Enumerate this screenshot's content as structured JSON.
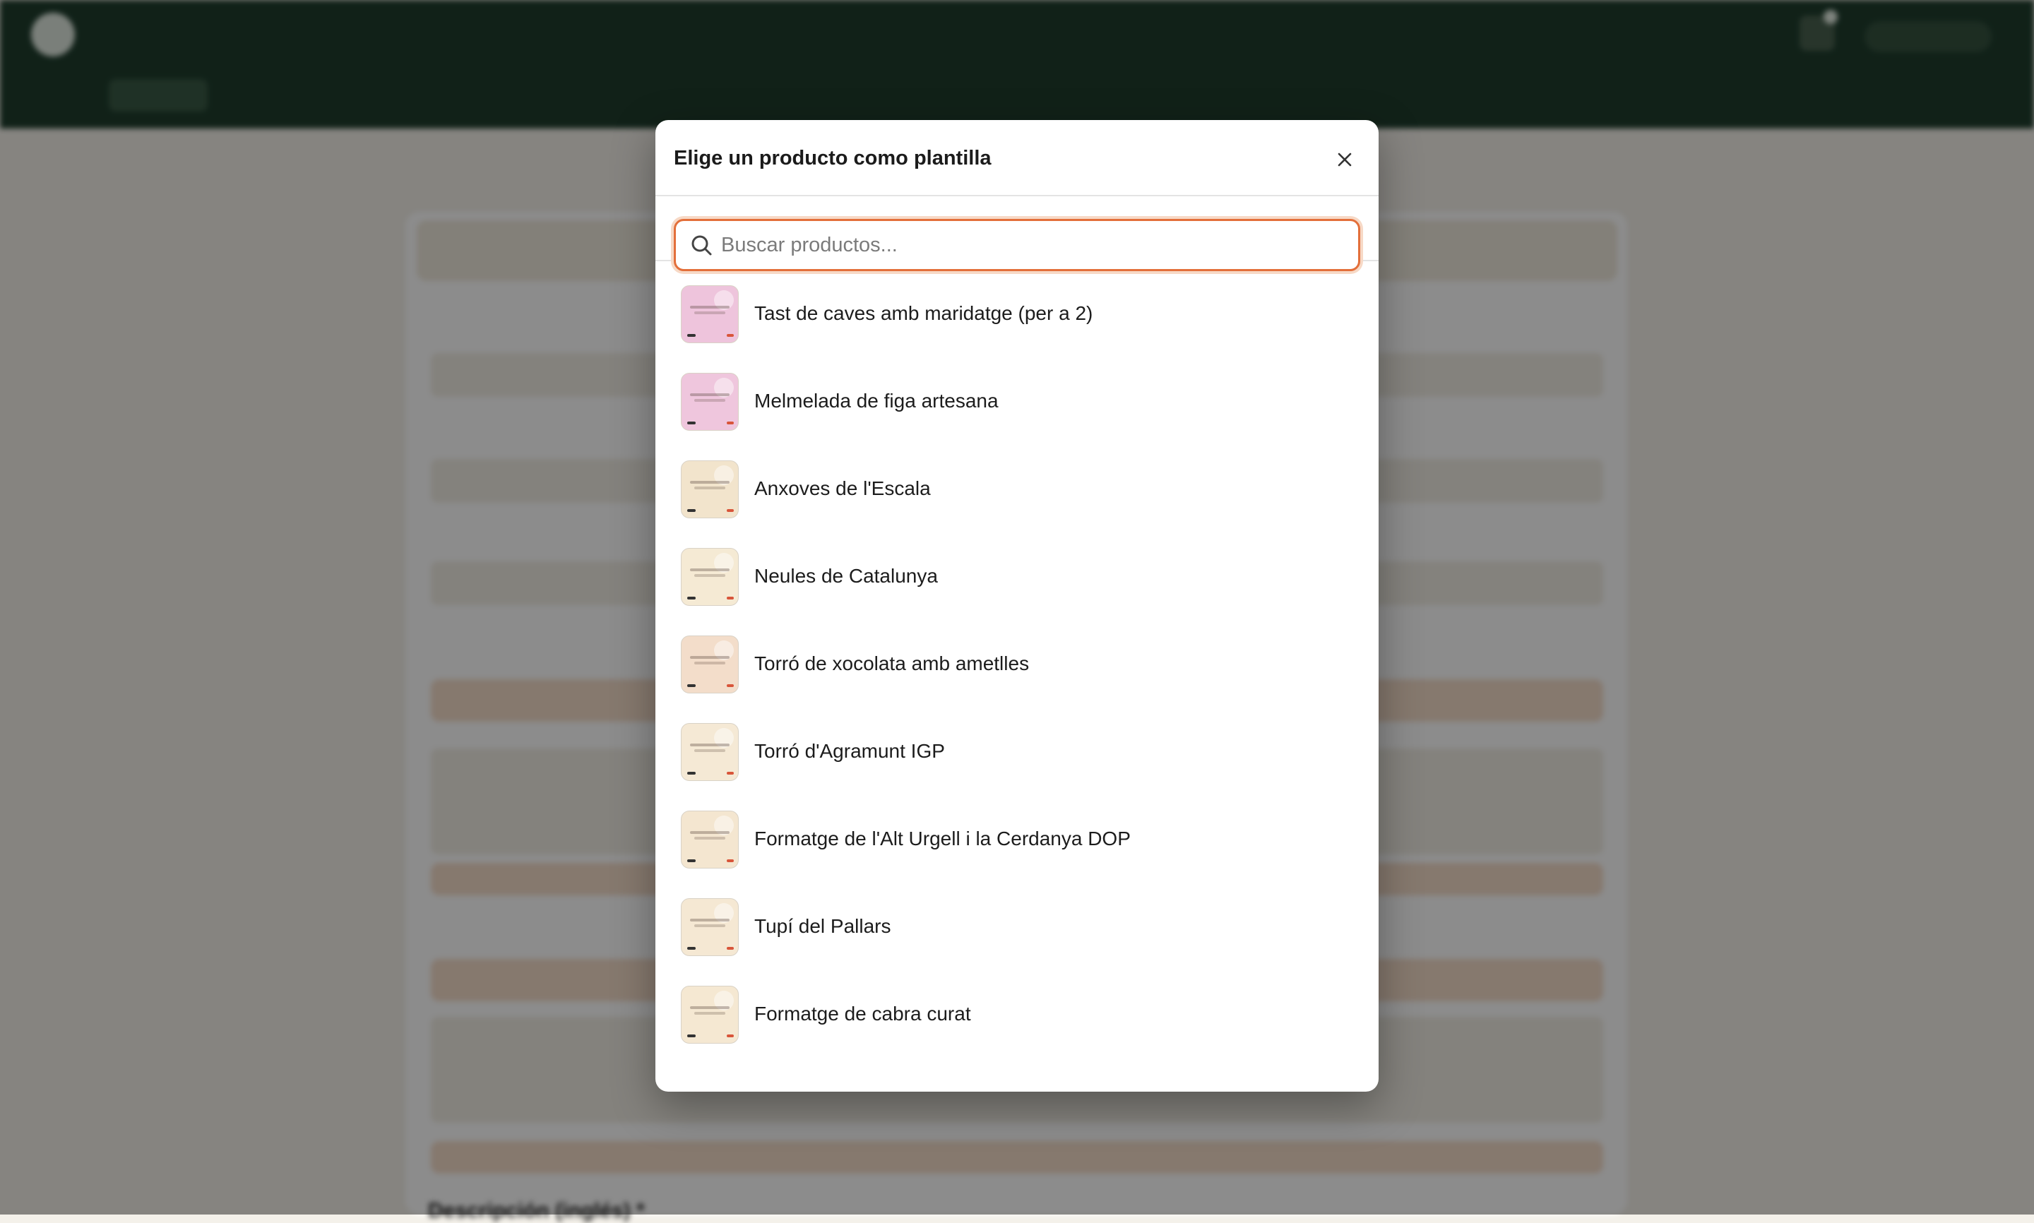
{
  "modal": {
    "title": "Elige un producto como plantilla",
    "search": {
      "placeholder": "Buscar productos...",
      "value": ""
    },
    "items": [
      {
        "label": "Tast de caves amb maridatge (per a 2)",
        "thumb_color": "#eec4dc"
      },
      {
        "label": "Melmelada de figa artesana",
        "thumb_color": "#efc6dd"
      },
      {
        "label": "Anxoves de l'Escala",
        "thumb_color": "#f2e4cc"
      },
      {
        "label": "Neules de Catalunya",
        "thumb_color": "#f5ead4"
      },
      {
        "label": "Torró de xocolata amb ametlles",
        "thumb_color": "#f3ddca"
      },
      {
        "label": "Torró d'Agramunt IGP",
        "thumb_color": "#f5e9d5"
      },
      {
        "label": "Formatge de l'Alt Urgell i la Cerdanya DOP",
        "thumb_color": "#f4e6d0"
      },
      {
        "label": "Tupí del Pallars",
        "thumb_color": "#f5e8d3"
      },
      {
        "label": "Formatge de cabra curat",
        "thumb_color": "#f5e8d2"
      }
    ]
  },
  "background": {
    "description_label": "Descripción (inglés) *"
  },
  "colors": {
    "header_green": "#1f3d2d",
    "accent_orange": "#e36f3a",
    "overlay": "rgba(0,0,0,0.45)"
  }
}
